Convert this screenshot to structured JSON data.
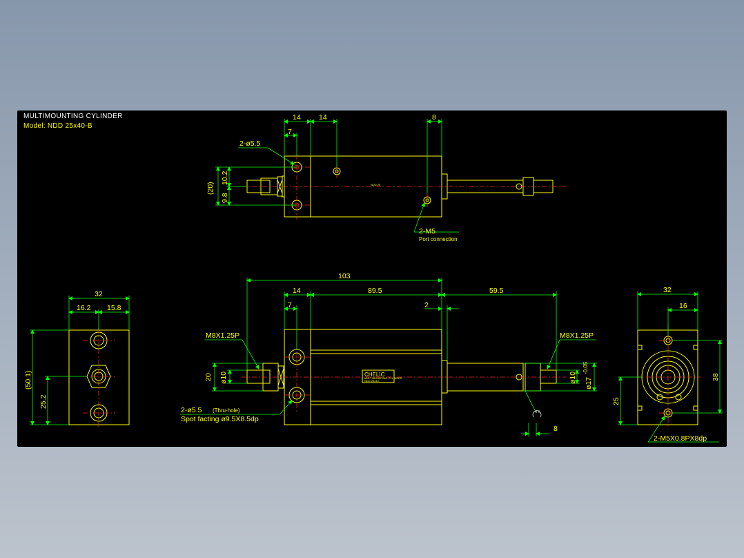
{
  "header": {
    "title": "MULTIMOUNTING CYLINDER",
    "model": "Model: NDD 25x40-B"
  },
  "top_view": {
    "dims": {
      "d14a": "14",
      "d14b": "14",
      "d7": "7",
      "d8": "8",
      "d20": "(20)",
      "d10_2": "10.2",
      "d9_8": "9.8"
    },
    "notes": {
      "holes": "2-ø5.5",
      "ports": "2-M5",
      "port_label": "Port connection",
      "body_label": "NDD 25"
    }
  },
  "front_view": {
    "dims": {
      "d103": "103",
      "d14": "14",
      "d89_5": "89.5",
      "d59_5": "59.5",
      "d7": "7",
      "d2": "2",
      "d20": "20",
      "d10l": "ø10",
      "d10r": "ø10",
      "d17": "ø17",
      "d17tol": "-0.05",
      "d8": "8"
    },
    "notes": {
      "thread_left": "M8X1.25P",
      "thread_right": "M8X1.25P",
      "holes": "2-ø5.5",
      "holes_sub": "(Thru-hole)",
      "spot_facing": "Spot facting  ø9.5X8.5dp",
      "brand": "CHELIC",
      "brand_sub1": "MULTIMOUNTING CYLINDER",
      "brand_sub2": "NDD 25x40"
    }
  },
  "left_view": {
    "dims": {
      "d32": "32",
      "d16_2": "16.2",
      "d15_8": "15.8",
      "d50_1": "(50.1)",
      "d25_2": "25.2"
    }
  },
  "right_view": {
    "dims": {
      "d32": "32",
      "d16": "16",
      "d38": "38",
      "d25": "25"
    },
    "notes": {
      "thread": "2-M5X0.8PX8dp"
    }
  },
  "colors": {
    "outline": "#ffff00",
    "dimension": "#00ff00",
    "centerline": "#ff2020",
    "background": "#000000"
  }
}
